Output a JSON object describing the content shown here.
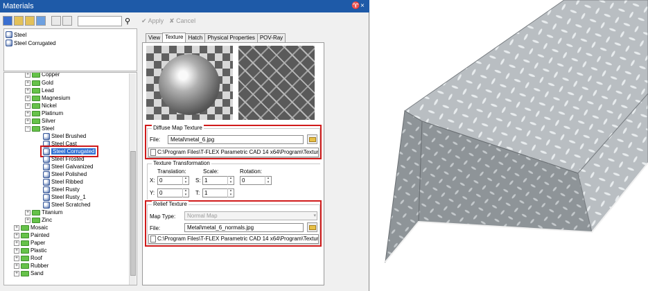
{
  "window": {
    "title": "Materials",
    "pin_icon": "♈",
    "close_icon": "×"
  },
  "toolbar": {
    "apply_label": "Apply",
    "cancel_label": "Cancel"
  },
  "libraries": [
    {
      "label": "Steel"
    },
    {
      "label": "Steel Corrugated"
    }
  ],
  "tree": {
    "items": [
      {
        "label": "Copper",
        "level": 1,
        "expander": "+"
      },
      {
        "label": "Gold",
        "level": 1,
        "expander": "+"
      },
      {
        "label": "Lead",
        "level": 1,
        "expander": "+"
      },
      {
        "label": "Magnesium",
        "level": 1,
        "expander": "+"
      },
      {
        "label": "Nickel",
        "level": 1,
        "expander": "+"
      },
      {
        "label": "Platinum",
        "level": 1,
        "expander": "+"
      },
      {
        "label": "Silver",
        "level": 1,
        "expander": "+"
      },
      {
        "label": "Steel",
        "level": 1,
        "expander": "−"
      },
      {
        "label": "Steel Brushed",
        "level": 2
      },
      {
        "label": "Steel Cast",
        "level": 2
      },
      {
        "label": "Steel Corrugated",
        "level": 2,
        "selected": true
      },
      {
        "label": "Steel Frosted",
        "level": 2
      },
      {
        "label": "Steel Galvanized",
        "level": 2
      },
      {
        "label": "Steel Polished",
        "level": 2
      },
      {
        "label": "Steel Ribbed",
        "level": 2
      },
      {
        "label": "Steel Rusty",
        "level": 2
      },
      {
        "label": "Steel Rusty_1",
        "level": 2
      },
      {
        "label": "Steel Scratched",
        "level": 2
      },
      {
        "label": "Titanium",
        "level": 1,
        "expander": "+"
      },
      {
        "label": "Zinc",
        "level": 1,
        "expander": "+"
      },
      {
        "label": "Mosaic",
        "level": 0,
        "expander": "+"
      },
      {
        "label": "Painted",
        "level": 0,
        "expander": "+"
      },
      {
        "label": "Paper",
        "level": 0,
        "expander": "+"
      },
      {
        "label": "Plastic",
        "level": 0,
        "expander": "+"
      },
      {
        "label": "Roof",
        "level": 0,
        "expander": "+"
      },
      {
        "label": "Rubber",
        "level": 0,
        "expander": "+"
      },
      {
        "label": "Sand",
        "level": 0,
        "expander": "+"
      }
    ]
  },
  "tabs": [
    "View",
    "Texture",
    "Hatch",
    "Physical Properties",
    "POV-Ray"
  ],
  "active_tab": "Texture",
  "diffuse": {
    "title": "Diffuse Map Texture",
    "file_label": "File:",
    "file_value": "Metal\\metal_6.jpg",
    "path": "C:\\Program Files\\T-FLEX Parametric CAD 14 x64\\Program\\Textures\\I"
  },
  "transform": {
    "title": "Texture Transformation",
    "translation_label": "Translation:",
    "scale_label": "Scale:",
    "rotation_label": "Rotation:",
    "x_label": "X:",
    "y_label": "Y:",
    "s_label": "S:",
    "t_label": "T:",
    "translation_x": "0",
    "translation_y": "0",
    "scale_s": "1",
    "scale_t": "1",
    "rotation": "0"
  },
  "relief": {
    "title": "Relief Texture",
    "map_type_label": "Map Type:",
    "map_type_value": "Normal Map",
    "file_label": "File:",
    "file_value": "Metal\\metal_6_normals.jpg",
    "path": "C:\\Program Files\\T-FLEX Parametric CAD 14 x64\\Program\\Textures\\I"
  },
  "colors": {
    "title_bar": "#1e5aa8",
    "selection": "#2e6fd3",
    "highlight_box": "#d01a1a",
    "folder": "#66c24a"
  }
}
